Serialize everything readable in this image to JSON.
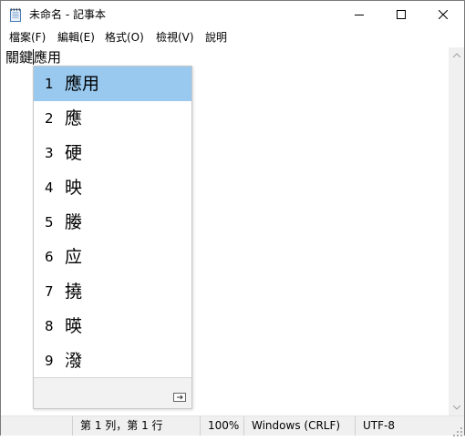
{
  "window": {
    "title": "未命名 - 記事本",
    "icons": {
      "app": "notepad-icon",
      "minimize": "minimize-icon",
      "maximize": "maximize-icon",
      "close": "close-icon"
    }
  },
  "menu": {
    "file": "檔案(F)",
    "edit": "編輯(E)",
    "format": "格式(O)",
    "view": "檢視(V)",
    "help": "說明"
  },
  "editor": {
    "committed_text": "關鍵",
    "composing_text": "應用"
  },
  "ime": {
    "selected_index": 0,
    "selection_color": "#99c9ef",
    "candidates": [
      {
        "num": "1",
        "text": "應用"
      },
      {
        "num": "2",
        "text": "應"
      },
      {
        "num": "3",
        "text": "硬"
      },
      {
        "num": "4",
        "text": "映"
      },
      {
        "num": "5",
        "text": "媵"
      },
      {
        "num": "6",
        "text": "应"
      },
      {
        "num": "7",
        "text": "撓"
      },
      {
        "num": "8",
        "text": "暎"
      },
      {
        "num": "9",
        "text": "潑"
      }
    ],
    "footer_icon": "expand-candidates-icon"
  },
  "statusbar": {
    "position": "第 1 列，第 1 行",
    "zoom": "100%",
    "line_ending": "Windows (CRLF)",
    "encoding": "UTF-8"
  }
}
